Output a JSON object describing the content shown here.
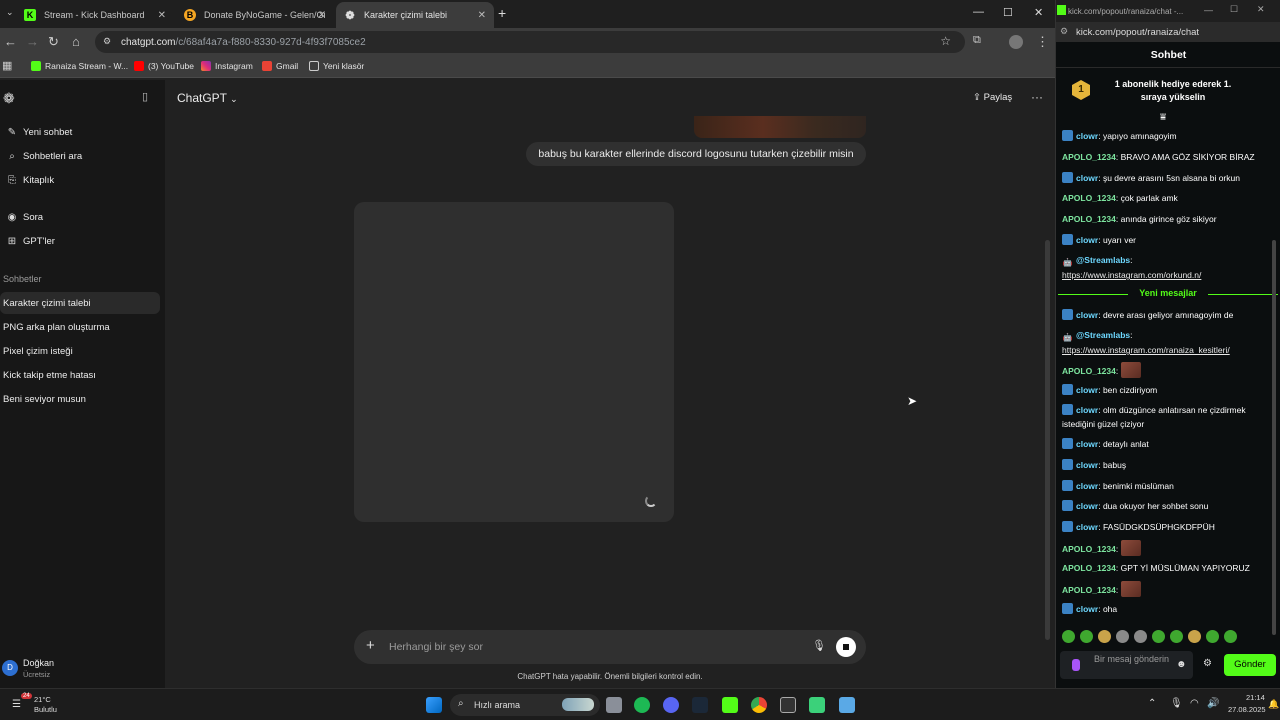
{
  "browser": {
    "tabs": [
      {
        "title": "Stream - Kick Dashboard",
        "icon": "kick-icon"
      },
      {
        "title": "Donate ByNoGame - Gelen/Gi",
        "icon": "bynogame-icon"
      },
      {
        "title": "Karakter çizimi talebi",
        "icon": "chatgpt-icon"
      }
    ],
    "url_host": "chatgpt.com",
    "url_path": "/c/68af4a7a-f880-8330-927d-4f93f7085ce2",
    "bookmarks": [
      "Ranaiza Stream - W...",
      "(3) YouTube",
      "Instagram",
      "Gmail",
      "Yeni klasör"
    ]
  },
  "chatgpt": {
    "sidebar": {
      "nav": [
        "Yeni sohbet",
        "Sohbetleri ara",
        "Kitaplık",
        "Sora",
        "GPT'ler"
      ],
      "section_title": "Sohbetler",
      "conversations": [
        "Karakter çizimi talebi",
        "PNG arka plan oluşturma",
        "Pixel çizim isteği",
        "Kick takip etme hatası",
        "Beni seviyor musun"
      ],
      "user_initial": "D",
      "user_name": "Doğkan",
      "user_plan": "Ücretsiz"
    },
    "header": {
      "title": "ChatGPT",
      "share_label": "Paylaş"
    },
    "user_message": "babuş bu karakter ellerinde discord logosunu tutarken çizebilir misin",
    "composer_placeholder": "Herhangi bir şey sor",
    "disclaimer": "ChatGPT hata yapabilir. Önemli bilgileri kontrol edin."
  },
  "kick": {
    "window_title": "kick.com/popout/ranaiza/chat -...",
    "url": "kick.com/popout/ranaiza/chat",
    "header": "Sohbet",
    "pinned_rank": "1",
    "pinned_text": "1 abonelik hediye ederek 1. sıraya yükselin",
    "new_messages_label": "Yeni mesajlar",
    "messages_before": [
      {
        "user": "clowr",
        "text": "yapıyo amınagoyim"
      },
      {
        "user": "APOLO_1234",
        "text": "BRAVO AMA GÖZ SİKİYOR BİRAZ"
      },
      {
        "user": "clowr",
        "text": "şu devre arasını 5sn alsana bi orkun"
      },
      {
        "user": "APOLO_1234",
        "text": "çok parlak amk"
      },
      {
        "user": "APOLO_1234",
        "text": "anında girince göz sikiyor"
      },
      {
        "user": "clowr",
        "text": "uyarı ver"
      },
      {
        "user": "@Streamlabs",
        "text": "https://www.instagram.com/orkund.n/"
      }
    ],
    "messages_after": [
      {
        "user": "clowr",
        "text": "devre arası geliyor amınagoyim de"
      },
      {
        "user": "@Streamlabs",
        "text": "https://www.instagram.com/ranaiza_kesitleri/"
      },
      {
        "user": "APOLO_1234",
        "text": ""
      },
      {
        "user": "clowr",
        "text": "ben cizdiriyom"
      },
      {
        "user": "clowr",
        "text": "olm düzgünce anlatırsan ne çizdirmek istediğini güzel çiziyor"
      },
      {
        "user": "clowr",
        "text": "detaylı anlat"
      },
      {
        "user": "clowr",
        "text": "babuş"
      },
      {
        "user": "clowr",
        "text": "benimki müslüman"
      },
      {
        "user": "clowr",
        "text": "dua okuyor her sohbet sonu"
      },
      {
        "user": "clowr",
        "text": "FASÜDGKDSÜPHGKDFPÜH"
      },
      {
        "user": "APOLO_1234",
        "text": ""
      },
      {
        "user": "APOLO_1234",
        "text": "GPT Yİ MÜSLÜMAN YAPIYORUZ"
      },
      {
        "user": "APOLO_1234",
        "text": ""
      },
      {
        "user": "clowr",
        "text": "oha"
      }
    ],
    "input_placeholder": "Bir mesaj gönderin",
    "send_label": "Gönder",
    "colors": {
      "accent": "#53fc18",
      "clowr": "#6ed8ff",
      "apolo": "#7ee6a0"
    }
  },
  "taskbar": {
    "weather_temp": "21°C",
    "weather_text": "Bulutlu",
    "notification_count": "24",
    "search_label": "Hızlı arama",
    "time": "21:14",
    "date": "27.08.2025"
  }
}
